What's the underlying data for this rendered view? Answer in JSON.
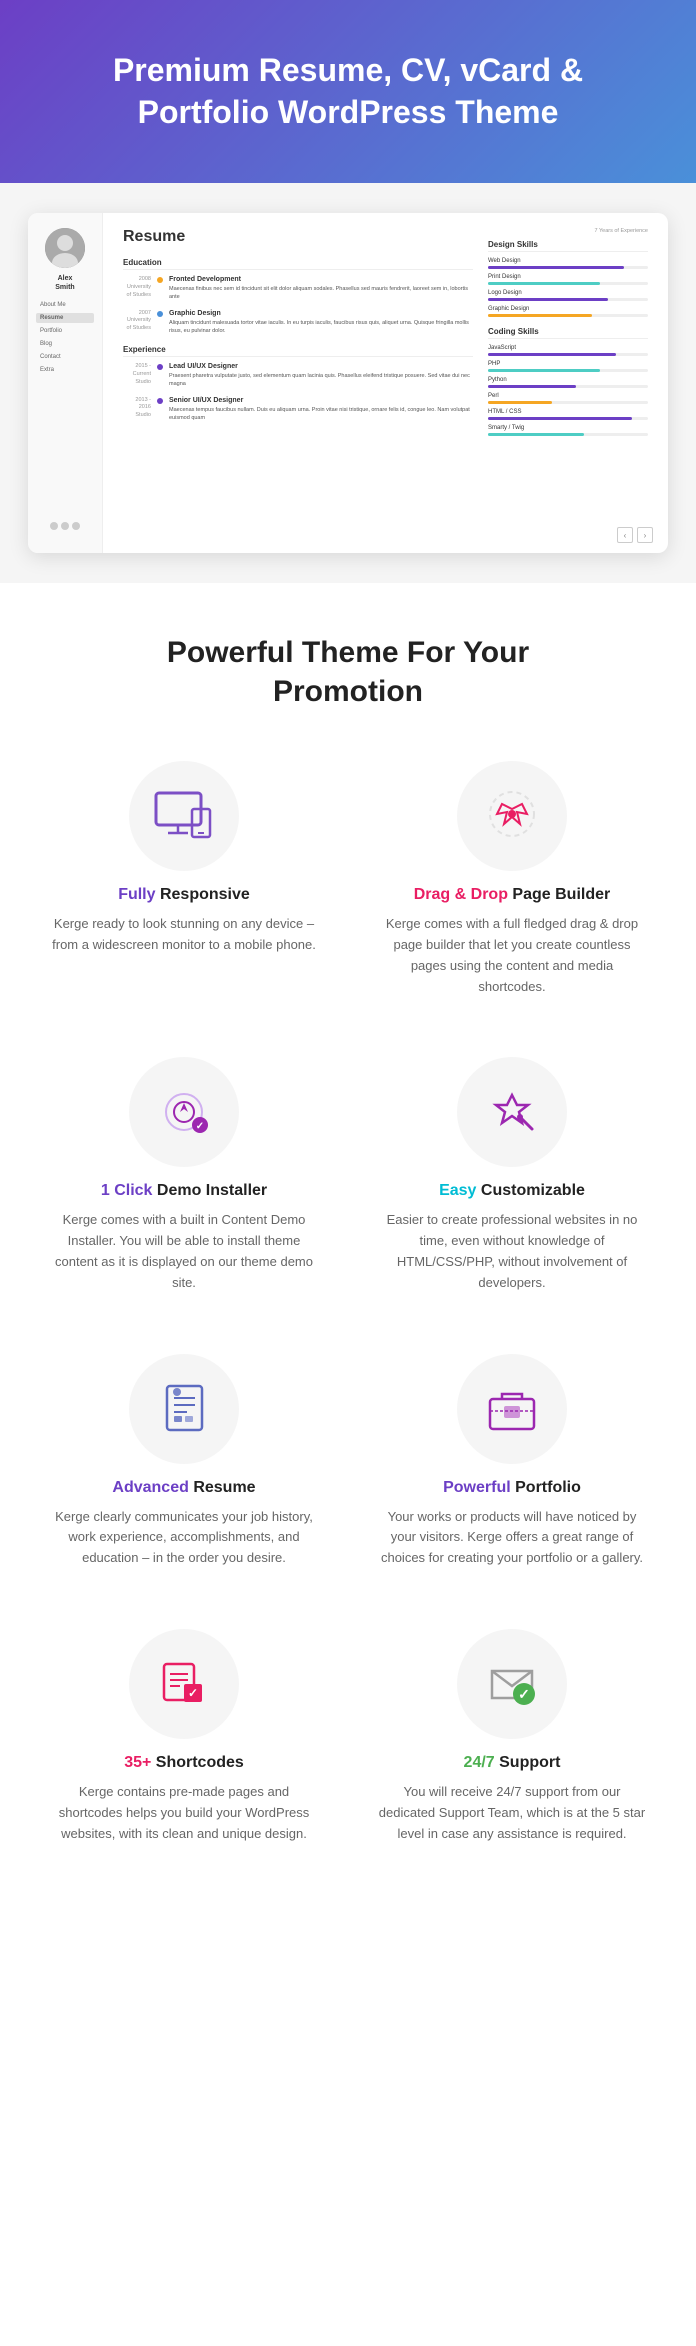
{
  "hero": {
    "title": "Premium Resume, CV, vCard & Portfolio WordPress Theme"
  },
  "resume_preview": {
    "name": "Alex Smith",
    "title": "Resume",
    "nav_items": [
      "About Me",
      "Resume",
      "Portfolio",
      "Blog",
      "Contact",
      "Extra"
    ],
    "years_badge": "7 Years of Experience",
    "education_title": "Education",
    "education_entries": [
      {
        "year": "2008",
        "institution": "University of Studies",
        "dot_color": "orange",
        "text": "Maecenas finibus nec sem id tincidunt sit elit dolor aliquam sodales. Phasellus sed mauris fendrerit, laoreet sem in, lobortis ante"
      },
      {
        "year": "2007",
        "institution": "University of Studies",
        "dot_color": "blue",
        "text": "Aliquam tincidunt malesuada tortor vitae iaculis. In eu turpis iaculis, faucibus risus quis, aliquet urna. Quisque fringilla mollis risus, eu pulvinar dolor."
      }
    ],
    "experience_title": "Experience",
    "experience_entries": [
      {
        "period": "2015 - Current",
        "place": "Studio",
        "title": "Lead UI/UX Designer",
        "text": "Praesent pharetra vulputate justo, sed elementum quam lacinia quis. Phasellus eleifend tristique posuere. Sed vitae dui nec magna"
      },
      {
        "period": "2013 - 2016",
        "place": "Studio",
        "title": "Senior UI/UX Designer",
        "text": "Maecenas tempus faucibus nullam. Duis eu aliquam urna. Proin vitae nisi tristique, ornare felis id, congue leo. Nam volutpat euismod quam"
      }
    ],
    "design_skills_title": "Design Skills",
    "design_skills": [
      {
        "name": "Web Design",
        "percent": 85
      },
      {
        "name": "Print Design",
        "percent": 70
      },
      {
        "name": "Logo Design",
        "percent": 75
      },
      {
        "name": "Graphic Design",
        "percent": 65
      }
    ],
    "coding_skills_title": "Coding Skills",
    "coding_skills": [
      {
        "name": "JavaScript",
        "percent": 80
      },
      {
        "name": "PHP",
        "percent": 70
      },
      {
        "name": "Python",
        "percent": 55
      },
      {
        "name": "Perl",
        "percent": 40
      },
      {
        "name": "HTML / CSS",
        "percent": 90
      },
      {
        "name": "Smarty / Twig",
        "percent": 60
      }
    ]
  },
  "features_section": {
    "title": "Powerful Theme For Your Promotion",
    "features": [
      {
        "icon": "🖥️",
        "icon_name": "monitor-icon",
        "title_plain": "Fully",
        "title_highlight": "Fully",
        "title_rest": " Responsive",
        "highlight_class": "highlight",
        "desc": "Kerge ready to look stunning on any device – from a widescreen monitor to a mobile phone."
      },
      {
        "icon": "🖱️",
        "icon_name": "drag-drop-icon",
        "title_highlight": "Drag & Drop",
        "title_rest": " Page Builder",
        "desc": "Kerge comes with a full fledged drag & drop page builder that let you create countless pages using the content and media shortcodes."
      },
      {
        "icon": "🎯",
        "icon_name": "click-icon",
        "title_highlight": "1 Click",
        "title_rest": " Demo Installer",
        "desc": "Kerge comes with a built in Content Demo Installer. You will be able to install theme content as it is displayed on our theme demo site."
      },
      {
        "icon": "⚙️",
        "icon_name": "customize-icon",
        "title_highlight": "Easy",
        "title_rest": " Customizable",
        "desc": "Easier to create professional websites in no time, even without knowledge of HTML/CSS/PHP, without involvement of developers."
      },
      {
        "icon": "📄",
        "icon_name": "resume-icon",
        "title_highlight": "Advanced",
        "title_rest": " Resume",
        "desc": "Kerge clearly communicates your job history, work experience, accomplishments, and education – in the order you desire."
      },
      {
        "icon": "💼",
        "icon_name": "portfolio-icon",
        "title_highlight": "Powerful",
        "title_rest": " Portfolio",
        "desc": "Your works or products will have noticed by your visitors. Kerge offers a great range of choices for creating your portfolio or a gallery."
      },
      {
        "icon": "🔖",
        "icon_name": "shortcodes-icon",
        "title_highlight": "35+",
        "title_rest": " Shortcodes",
        "desc": "Kerge contains pre-made pages and shortcodes helps you build your WordPress websites, with its clean and unique design."
      },
      {
        "icon": "✉️",
        "icon_name": "support-icon",
        "title_highlight": "24/7",
        "title_rest": " Support",
        "desc": "You will receive 24/7 support from our dedicated Support Team, which is at the 5 star level in case any assistance is required."
      }
    ]
  }
}
